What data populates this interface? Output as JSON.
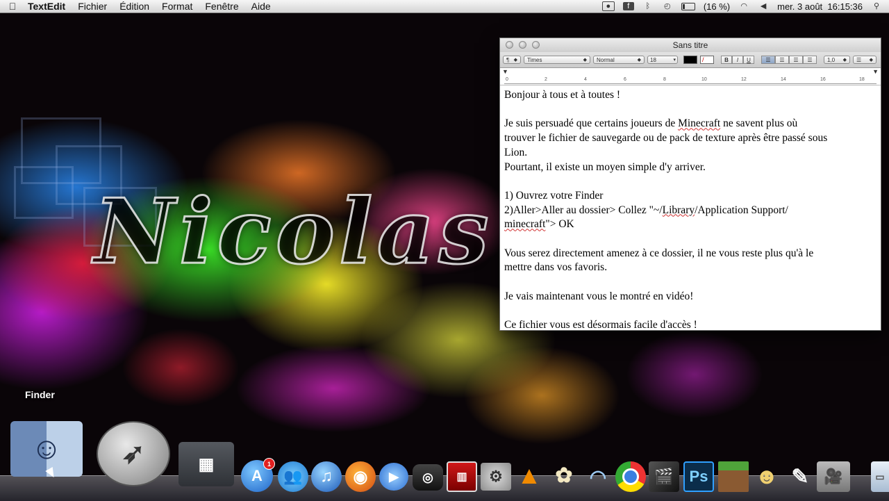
{
  "menubar": {
    "app_name": "TextEdit",
    "menus": [
      "Fichier",
      "Édition",
      "Format",
      "Fenêtre",
      "Aide"
    ],
    "battery_text": "(16 %)",
    "battery_level": 0.16,
    "clock": "mer. 3 août  16:15:36"
  },
  "wallpaper": {
    "text": "Nicolas C"
  },
  "window": {
    "title": "Sans titre",
    "toolbar": {
      "paragraph_style": "¶",
      "font_family": "Times",
      "font_style": "Normal",
      "font_size": "18",
      "bold": "B",
      "italic": "I",
      "underline": "U",
      "line_spacing": "1,0"
    },
    "ruler_labels": [
      "0",
      "2",
      "4",
      "6",
      "8",
      "10",
      "12",
      "14",
      "16",
      "18"
    ],
    "document_lines": [
      "Bonjour à tous et à toutes !",
      "",
      "Je suis persuadé que certains joueurs de Minecraft ne savent plus où",
      "trouver le fichier de sauvegarde ou de pack de texture après être passé sous",
      "Lion.",
      "Pourtant, il existe un moyen simple d'y arriver.",
      "",
      "1) Ouvrez votre Finder",
      "2)Aller>Aller au dossier> Collez \"~/Library/Application Support/",
      "minecraft\"> OK",
      "",
      "Vous serez directement amenez à ce dossier, il ne vous reste plus qu'à le",
      "mettre dans vos favoris.",
      "",
      "Je vais maintenant vous le montré en vidéo!",
      "",
      "Ce fichier vous est désormais facile d'accès !"
    ]
  },
  "dock": {
    "tooltip": "Finder",
    "app_store_badge": "1",
    "photoshop_label": "Ps"
  },
  "colors": {
    "menubar_bg": "#e8e8e8",
    "spell_underline": "#d03030"
  }
}
